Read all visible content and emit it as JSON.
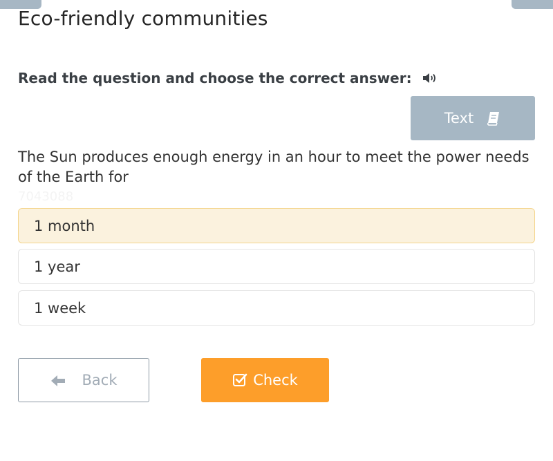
{
  "header": {
    "title": "Eco-friendly communities"
  },
  "task": {
    "instruction": "Read the question and choose the correct answer:",
    "instruction_icon": "speaker-icon",
    "text_button_label": "Text",
    "text_button_icon": "book-icon",
    "question": "The Sun produces enough energy in an hour to meet the power needs of the Earth for",
    "question_id": "7043088"
  },
  "options": [
    {
      "label": "1 month",
      "selected": true
    },
    {
      "label": "1 year",
      "selected": false
    },
    {
      "label": "1 week",
      "selected": false
    }
  ],
  "footer": {
    "back_label": "Back",
    "back_icon": "arrow-left-icon",
    "check_label": "Check",
    "check_icon": "checkbox-icon"
  },
  "colors": {
    "accent": "#fd9e2a",
    "secondary": "#a6b7c4",
    "selected_bg": "#fbf2de",
    "selected_border": "#f4d48a"
  }
}
